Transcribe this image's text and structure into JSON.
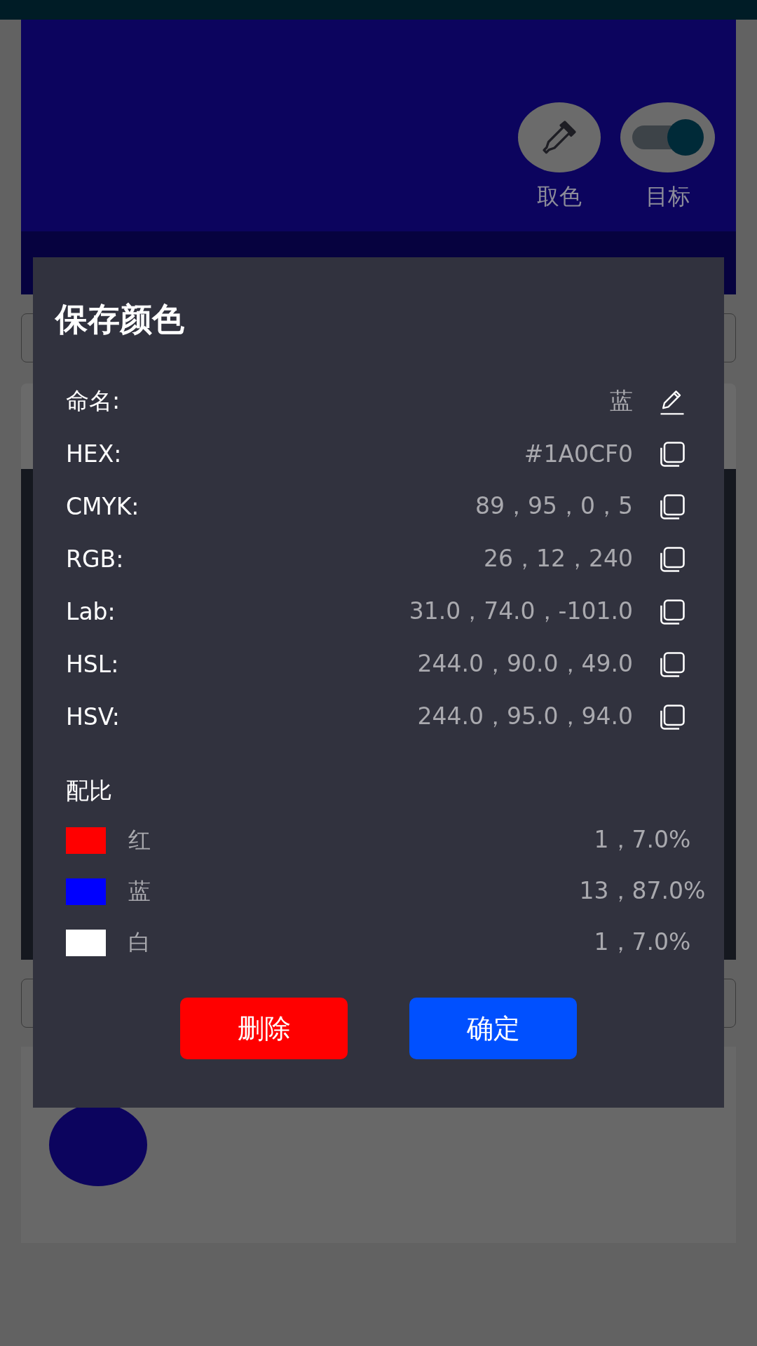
{
  "tools": [
    {
      "kind": "picker",
      "label": "取色"
    },
    {
      "kind": "toggle",
      "label": "目标",
      "on": true
    }
  ],
  "background_swatch": {
    "color": "#0c045e"
  },
  "dialog": {
    "title": "保存颜色",
    "fields": [
      {
        "kind": "edit",
        "label": "命名:",
        "value": "蓝"
      },
      {
        "kind": "copy",
        "label": "HEX:",
        "value": "#1A0CF0"
      },
      {
        "kind": "copy",
        "label": "CMYK:",
        "value": "89，95，0，5"
      },
      {
        "kind": "copy",
        "label": "RGB:",
        "value": "26，12，240"
      },
      {
        "kind": "copy",
        "label": "Lab:",
        "value": "31.0，74.0，-101.0"
      },
      {
        "kind": "copy",
        "label": "HSL:",
        "value": "244.0，90.0，49.0"
      },
      {
        "kind": "copy",
        "label": "HSV:",
        "value": "244.0，95.0，94.0"
      }
    ],
    "ratio_title": "配比",
    "ratio": [
      {
        "name": "红",
        "color": "#ff0000",
        "value": "1，7.0%"
      },
      {
        "name": "蓝",
        "color": "#0000ff",
        "value": "13，87.0%"
      },
      {
        "name": "白",
        "color": "#ffffff",
        "value": "1，7.0%"
      }
    ],
    "buttons": [
      {
        "kind": "delete",
        "label": "删除"
      },
      {
        "kind": "confirm",
        "label": "确定"
      }
    ]
  }
}
